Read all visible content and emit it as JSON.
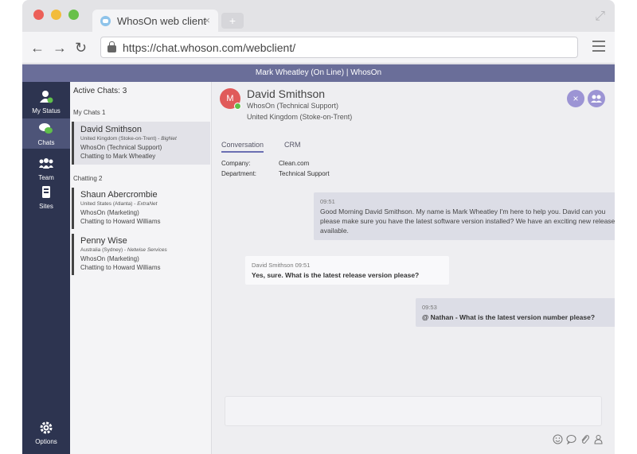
{
  "browser": {
    "tab_title": "WhosOn web client",
    "tab_close": "×",
    "new_tab": "+",
    "url": "https://chat.whoson.com/webclient/"
  },
  "app": {
    "title": "Mark Wheatley (On Line) | WhosOn"
  },
  "sidebar": {
    "items": [
      {
        "label": "My Status",
        "icon": "user-status-icon"
      },
      {
        "label": "Chats",
        "icon": "chat-bubbles-icon"
      },
      {
        "label": "Team",
        "icon": "team-icon"
      },
      {
        "label": "Sites",
        "icon": "sites-icon"
      }
    ],
    "options_label": "Options"
  },
  "chatlist": {
    "active_chats": "Active Chats: 3",
    "my_chats_label": "My Chats 1",
    "chatting_label": "Chatting 2",
    "chats": [
      {
        "name": "David Smithson",
        "location": "United Kingdom (Stoke-on-Trent)",
        "site": "BigNet",
        "dept": "WhosOn (Technical Support)",
        "agent": "Chatting to Mark Wheatley"
      },
      {
        "name": "Shaun Abercrombie",
        "location": "United States (Atlanta)",
        "site": "ExtraNet",
        "dept": "WhosOn (Marketing)",
        "agent": "Chatting to Howard Williams"
      },
      {
        "name": "Penny Wise",
        "location": "Australia (Sydney)",
        "site": "Netwise Services",
        "dept": "WhosOn (Marketing)",
        "agent": "Chatting to Howard Williams"
      }
    ]
  },
  "conversation": {
    "avatar_letter": "M",
    "name": "David Smithson",
    "dept": "WhosOn (Technical Support)",
    "location": "United Kingdom (Stoke-on-Trent)",
    "close_glyph": "×",
    "tabs": [
      "Conversation",
      "CRM"
    ],
    "company_label": "Company:",
    "company_value": "Clean.com",
    "department_label": "Department:",
    "department_value": "Technical Support",
    "messages": [
      {
        "meta": "09:51",
        "text": "Good Morning David Smithson. My name is Mark Wheatley I'm here to help you. David can you please make sure you have the latest software version installed? We have an exciting new release available."
      },
      {
        "meta": "David Smithson 09:51",
        "text": "Yes, sure. What is the latest release version please?"
      },
      {
        "meta": "09:53",
        "text": "@ Nathan - What is the latest version number please?"
      }
    ]
  },
  "colors": {
    "appbar": "#6a6e99",
    "sidebar": "#2d3450",
    "accent": "#9c94d4",
    "online": "#5fbf4a",
    "avatar": "#e05a5a"
  }
}
